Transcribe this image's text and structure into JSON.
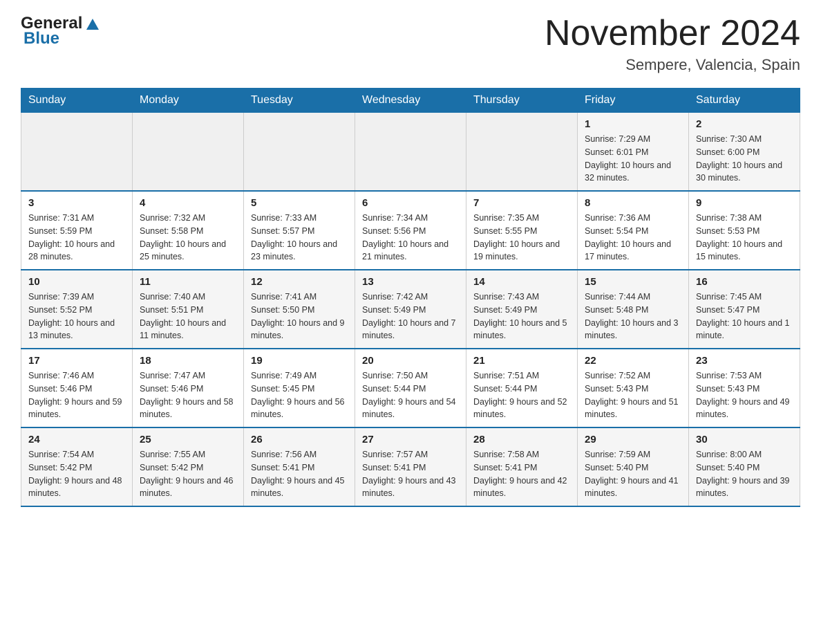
{
  "header": {
    "logo_general": "General",
    "logo_blue": "Blue",
    "month_title": "November 2024",
    "location": "Sempere, Valencia, Spain"
  },
  "weekdays": [
    "Sunday",
    "Monday",
    "Tuesday",
    "Wednesday",
    "Thursday",
    "Friday",
    "Saturday"
  ],
  "weeks": [
    [
      {
        "day": "",
        "sunrise": "",
        "sunset": "",
        "daylight": ""
      },
      {
        "day": "",
        "sunrise": "",
        "sunset": "",
        "daylight": ""
      },
      {
        "day": "",
        "sunrise": "",
        "sunset": "",
        "daylight": ""
      },
      {
        "day": "",
        "sunrise": "",
        "sunset": "",
        "daylight": ""
      },
      {
        "day": "",
        "sunrise": "",
        "sunset": "",
        "daylight": ""
      },
      {
        "day": "1",
        "sunrise": "Sunrise: 7:29 AM",
        "sunset": "Sunset: 6:01 PM",
        "daylight": "Daylight: 10 hours and 32 minutes."
      },
      {
        "day": "2",
        "sunrise": "Sunrise: 7:30 AM",
        "sunset": "Sunset: 6:00 PM",
        "daylight": "Daylight: 10 hours and 30 minutes."
      }
    ],
    [
      {
        "day": "3",
        "sunrise": "Sunrise: 7:31 AM",
        "sunset": "Sunset: 5:59 PM",
        "daylight": "Daylight: 10 hours and 28 minutes."
      },
      {
        "day": "4",
        "sunrise": "Sunrise: 7:32 AM",
        "sunset": "Sunset: 5:58 PM",
        "daylight": "Daylight: 10 hours and 25 minutes."
      },
      {
        "day": "5",
        "sunrise": "Sunrise: 7:33 AM",
        "sunset": "Sunset: 5:57 PM",
        "daylight": "Daylight: 10 hours and 23 minutes."
      },
      {
        "day": "6",
        "sunrise": "Sunrise: 7:34 AM",
        "sunset": "Sunset: 5:56 PM",
        "daylight": "Daylight: 10 hours and 21 minutes."
      },
      {
        "day": "7",
        "sunrise": "Sunrise: 7:35 AM",
        "sunset": "Sunset: 5:55 PM",
        "daylight": "Daylight: 10 hours and 19 minutes."
      },
      {
        "day": "8",
        "sunrise": "Sunrise: 7:36 AM",
        "sunset": "Sunset: 5:54 PM",
        "daylight": "Daylight: 10 hours and 17 minutes."
      },
      {
        "day": "9",
        "sunrise": "Sunrise: 7:38 AM",
        "sunset": "Sunset: 5:53 PM",
        "daylight": "Daylight: 10 hours and 15 minutes."
      }
    ],
    [
      {
        "day": "10",
        "sunrise": "Sunrise: 7:39 AM",
        "sunset": "Sunset: 5:52 PM",
        "daylight": "Daylight: 10 hours and 13 minutes."
      },
      {
        "day": "11",
        "sunrise": "Sunrise: 7:40 AM",
        "sunset": "Sunset: 5:51 PM",
        "daylight": "Daylight: 10 hours and 11 minutes."
      },
      {
        "day": "12",
        "sunrise": "Sunrise: 7:41 AM",
        "sunset": "Sunset: 5:50 PM",
        "daylight": "Daylight: 10 hours and 9 minutes."
      },
      {
        "day": "13",
        "sunrise": "Sunrise: 7:42 AM",
        "sunset": "Sunset: 5:49 PM",
        "daylight": "Daylight: 10 hours and 7 minutes."
      },
      {
        "day": "14",
        "sunrise": "Sunrise: 7:43 AM",
        "sunset": "Sunset: 5:49 PM",
        "daylight": "Daylight: 10 hours and 5 minutes."
      },
      {
        "day": "15",
        "sunrise": "Sunrise: 7:44 AM",
        "sunset": "Sunset: 5:48 PM",
        "daylight": "Daylight: 10 hours and 3 minutes."
      },
      {
        "day": "16",
        "sunrise": "Sunrise: 7:45 AM",
        "sunset": "Sunset: 5:47 PM",
        "daylight": "Daylight: 10 hours and 1 minute."
      }
    ],
    [
      {
        "day": "17",
        "sunrise": "Sunrise: 7:46 AM",
        "sunset": "Sunset: 5:46 PM",
        "daylight": "Daylight: 9 hours and 59 minutes."
      },
      {
        "day": "18",
        "sunrise": "Sunrise: 7:47 AM",
        "sunset": "Sunset: 5:46 PM",
        "daylight": "Daylight: 9 hours and 58 minutes."
      },
      {
        "day": "19",
        "sunrise": "Sunrise: 7:49 AM",
        "sunset": "Sunset: 5:45 PM",
        "daylight": "Daylight: 9 hours and 56 minutes."
      },
      {
        "day": "20",
        "sunrise": "Sunrise: 7:50 AM",
        "sunset": "Sunset: 5:44 PM",
        "daylight": "Daylight: 9 hours and 54 minutes."
      },
      {
        "day": "21",
        "sunrise": "Sunrise: 7:51 AM",
        "sunset": "Sunset: 5:44 PM",
        "daylight": "Daylight: 9 hours and 52 minutes."
      },
      {
        "day": "22",
        "sunrise": "Sunrise: 7:52 AM",
        "sunset": "Sunset: 5:43 PM",
        "daylight": "Daylight: 9 hours and 51 minutes."
      },
      {
        "day": "23",
        "sunrise": "Sunrise: 7:53 AM",
        "sunset": "Sunset: 5:43 PM",
        "daylight": "Daylight: 9 hours and 49 minutes."
      }
    ],
    [
      {
        "day": "24",
        "sunrise": "Sunrise: 7:54 AM",
        "sunset": "Sunset: 5:42 PM",
        "daylight": "Daylight: 9 hours and 48 minutes."
      },
      {
        "day": "25",
        "sunrise": "Sunrise: 7:55 AM",
        "sunset": "Sunset: 5:42 PM",
        "daylight": "Daylight: 9 hours and 46 minutes."
      },
      {
        "day": "26",
        "sunrise": "Sunrise: 7:56 AM",
        "sunset": "Sunset: 5:41 PM",
        "daylight": "Daylight: 9 hours and 45 minutes."
      },
      {
        "day": "27",
        "sunrise": "Sunrise: 7:57 AM",
        "sunset": "Sunset: 5:41 PM",
        "daylight": "Daylight: 9 hours and 43 minutes."
      },
      {
        "day": "28",
        "sunrise": "Sunrise: 7:58 AM",
        "sunset": "Sunset: 5:41 PM",
        "daylight": "Daylight: 9 hours and 42 minutes."
      },
      {
        "day": "29",
        "sunrise": "Sunrise: 7:59 AM",
        "sunset": "Sunset: 5:40 PM",
        "daylight": "Daylight: 9 hours and 41 minutes."
      },
      {
        "day": "30",
        "sunrise": "Sunrise: 8:00 AM",
        "sunset": "Sunset: 5:40 PM",
        "daylight": "Daylight: 9 hours and 39 minutes."
      }
    ]
  ]
}
